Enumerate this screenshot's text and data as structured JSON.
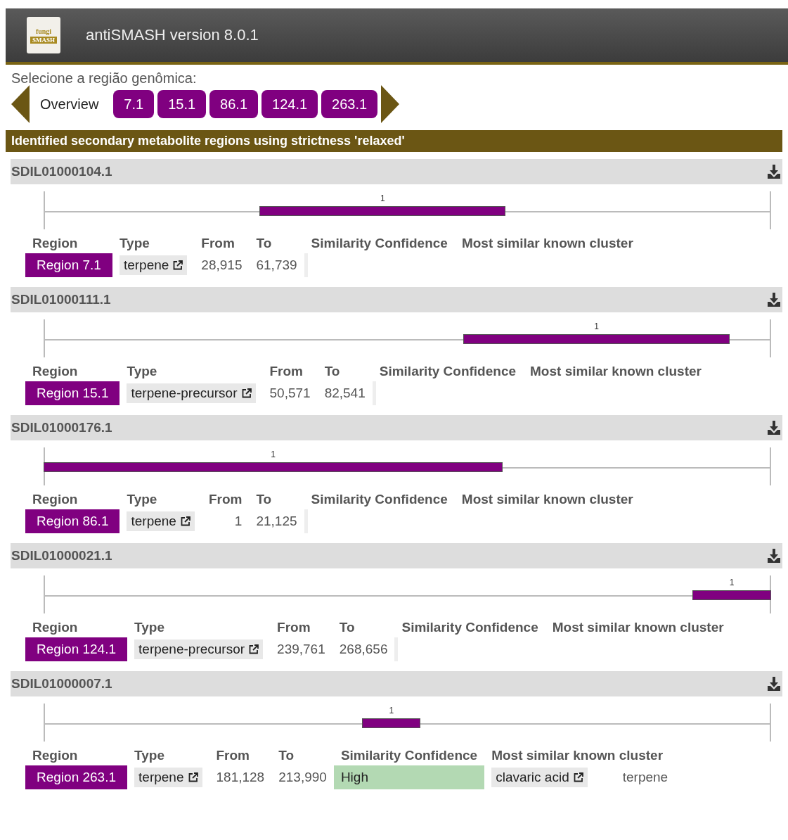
{
  "header": {
    "logo_top": "fungi",
    "logo_bottom": "SMASH",
    "title": "antiSMASH version 8.0.1"
  },
  "nav": {
    "label": "Selecione a região genômica:",
    "overview": "Overview",
    "buttons": [
      "7.1",
      "15.1",
      "86.1",
      "124.1",
      "263.1"
    ]
  },
  "banner": "Identified secondary metabolite regions using strictness 'relaxed'",
  "records": [
    {
      "name": "SDIL01000104.1",
      "marker": "1",
      "columns": [
        "Region",
        "Type",
        "From",
        "To",
        "Similarity Confidence",
        "Most similar known cluster"
      ],
      "region": "Region 7.1",
      "type": "terpene",
      "from": "28,915",
      "to": "61,739"
    },
    {
      "name": "SDIL01000111.1",
      "marker": "1",
      "columns": [
        "Region",
        "Type",
        "From",
        "To",
        "Similarity Confidence",
        "Most similar known cluster"
      ],
      "region": "Region 15.1",
      "type": "terpene-precursor",
      "from": "50,571",
      "to": "82,541"
    },
    {
      "name": "SDIL01000176.1",
      "marker": "1",
      "columns": [
        "Region",
        "Type",
        "From",
        "To",
        "Similarity Confidence",
        "Most similar known cluster"
      ],
      "region": "Region 86.1",
      "type": "terpene",
      "from": "1",
      "to": "21,125"
    },
    {
      "name": "SDIL01000021.1",
      "marker": "1",
      "columns": [
        "Region",
        "Type",
        "From",
        "To",
        "Similarity Confidence",
        "Most similar known cluster"
      ],
      "region": "Region 124.1",
      "type": "terpene-precursor",
      "from": "239,761",
      "to": "268,656"
    },
    {
      "name": "SDIL01000007.1",
      "marker": "1",
      "columns": [
        "Region",
        "Type",
        "From",
        "To",
        "Similarity Confidence",
        "Most similar known cluster"
      ],
      "region": "Region 263.1",
      "type": "terpene",
      "from": "181,128",
      "to": "213,990",
      "similarity": "High",
      "cluster": "clavaric acid",
      "cluster_type": "terpene"
    }
  ]
}
